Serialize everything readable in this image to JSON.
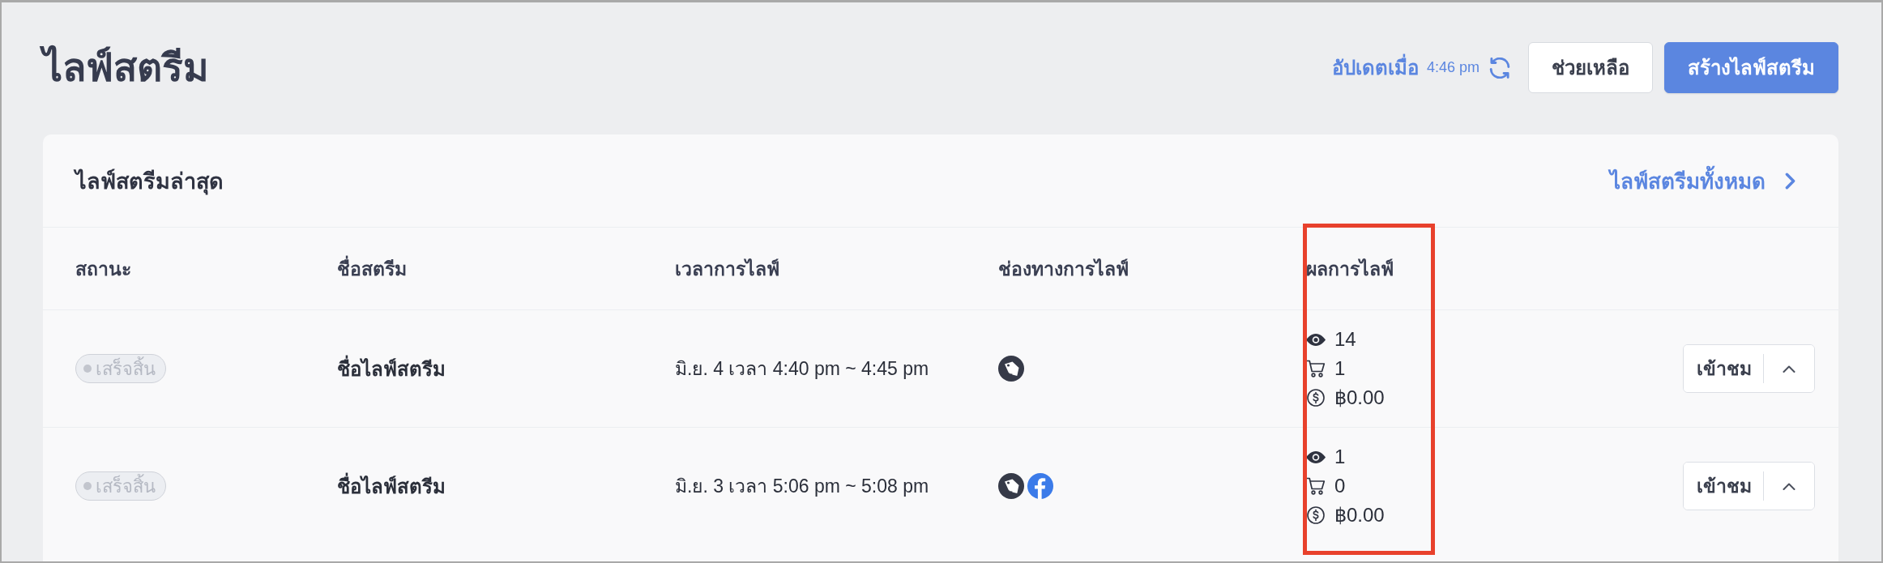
{
  "page": {
    "title": "ไลฟ์สตรีม",
    "updated_label": "อัปเดตเมื่อ",
    "updated_time": "4:46 pm",
    "buttons": [
      {
        "label": "ช่วยเหลือ",
        "kind": "secondary"
      },
      {
        "label": "สร้างไลฟ์สตรีม",
        "kind": "primary"
      }
    ]
  },
  "latest": {
    "title": "ไลฟ์สตรีมล่าสุด",
    "link": "ไลฟ์สตรีมทั้งหมด",
    "table": {
      "columns": [
        {
          "label": "สถานะ",
          "highlighted": false
        },
        {
          "label": "ชื่อสตรีม",
          "highlighted": false
        },
        {
          "label": "เวลาการไลฟ์",
          "highlighted": false
        },
        {
          "label": "ช่องทางการไลฟ์",
          "highlighted": false
        },
        {
          "label": "ผลการไลฟ์",
          "highlighted": true
        }
      ],
      "rows": [
        {
          "status": "เสร็จสิ้น",
          "name": "ชื่อไลฟ์สตรีม",
          "time": "มิ.ย. 4 เวลา 4:40 pm ~ 4:45 pm",
          "channels": [
            {
              "kind": "shop"
            }
          ],
          "results": [
            {
              "kind": "views",
              "value": "14"
            },
            {
              "kind": "orders",
              "value": "1"
            },
            {
              "kind": "sales",
              "value": "฿0.00"
            }
          ],
          "action": "เข้าชม"
        },
        {
          "status": "เสร็จสิ้น",
          "name": "ชื่อไลฟ์สตรีม",
          "time": "มิ.ย. 3 เวลา 5:06 pm ~ 5:08 pm",
          "channels": [
            {
              "kind": "shop"
            },
            {
              "kind": "facebook"
            }
          ],
          "results": [
            {
              "kind": "views",
              "value": "1"
            },
            {
              "kind": "orders",
              "value": "0"
            },
            {
              "kind": "sales",
              "value": "฿0.00"
            }
          ],
          "action": "เข้าชม"
        }
      ]
    }
  }
}
